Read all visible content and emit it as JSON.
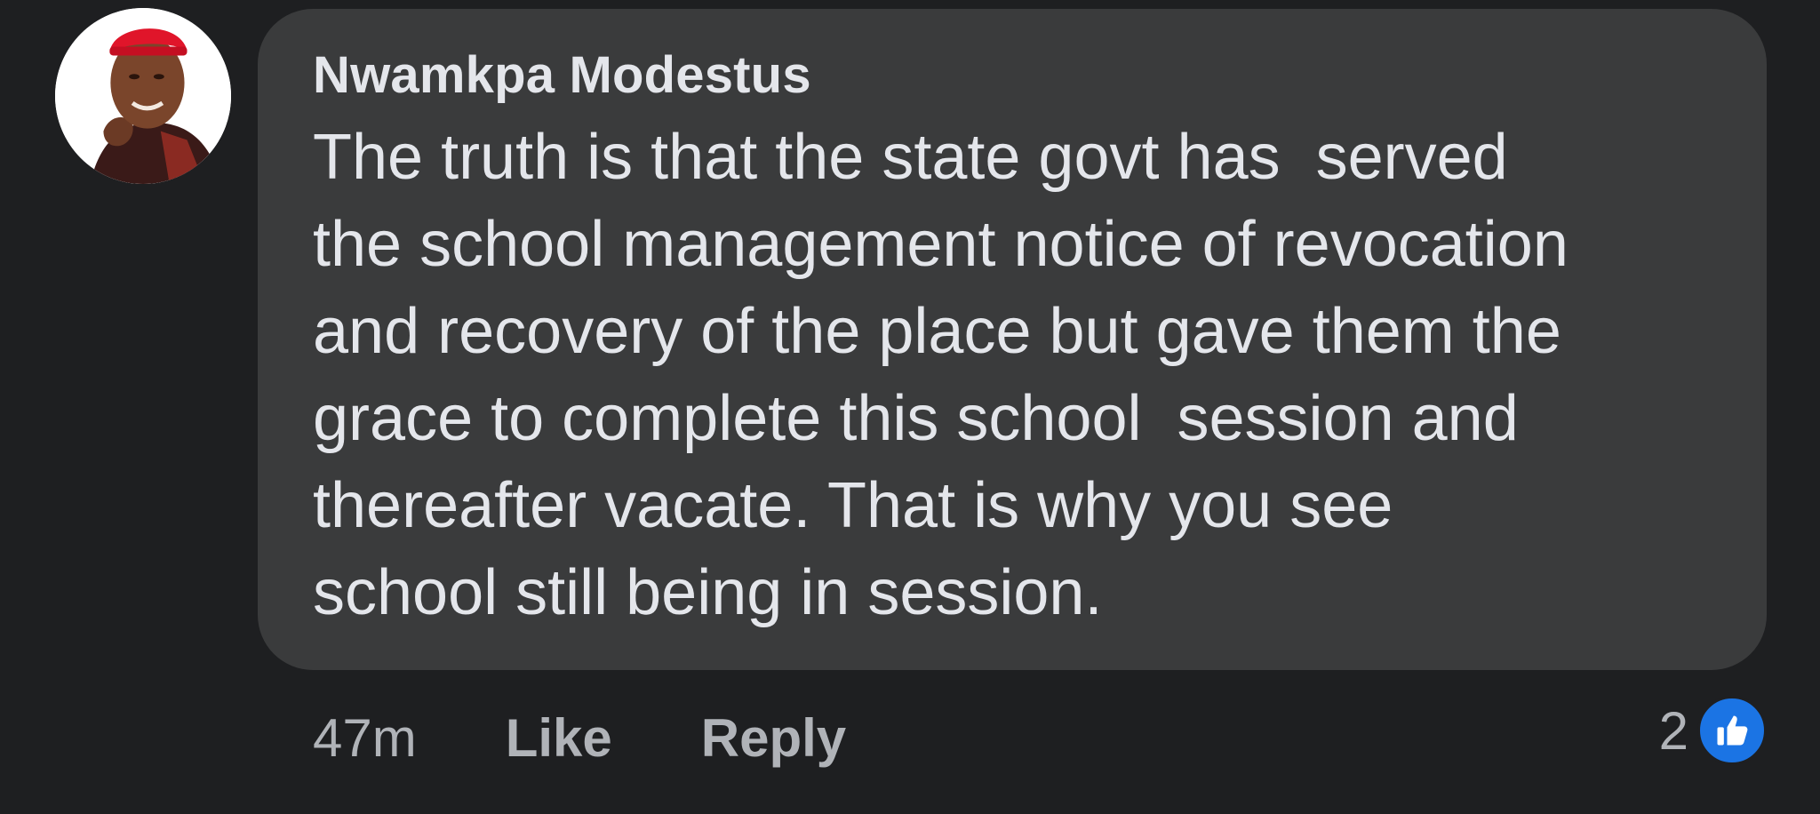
{
  "comment": {
    "author": "Nwamkpa Modestus",
    "avatar_icon": "profile-photo",
    "text_lines": [
      "The truth is that the state govt has  served",
      "the school management notice of revocation",
      "and recovery of the place but gave them the",
      "grace to complete this school  session and",
      "thereafter vacate. That is why you see",
      "school still being in session."
    ],
    "timestamp": "47m",
    "like_label": "Like",
    "reply_label": "Reply",
    "reaction_count": "2",
    "reaction_icon": "like-icon"
  },
  "colors": {
    "background": "#1e1f21",
    "bubble": "#3a3b3c",
    "primary_text": "#e4e6eb",
    "secondary_text": "#b0b3b8",
    "like_blue": "#1b74e4"
  }
}
